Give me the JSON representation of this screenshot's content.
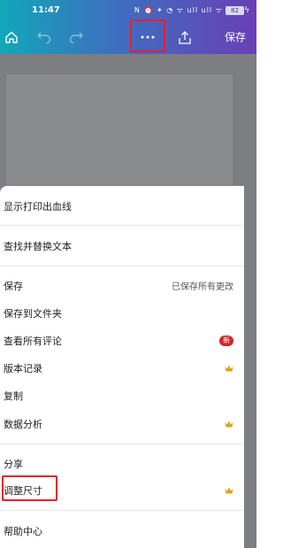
{
  "status_bar": {
    "time": "11:47",
    "icons_text": "N ⏰ ✦ ◔ ᯤ ull ull ᯤ",
    "battery": "82",
    "bolt": "ϟ"
  },
  "toolbar": {
    "save_label": "保存",
    "icons": [
      "home-icon",
      "undo-icon",
      "redo-icon",
      "more-icon",
      "share-upload-icon"
    ]
  },
  "menu": {
    "print_bleed": "显示打印出血线",
    "find_replace": "查找并替换文本",
    "save": "保存",
    "save_status": "已保存所有更改",
    "save_to_folder": "保存到文件夹",
    "view_comments": "查看所有评论",
    "new_badge": "新",
    "version_history": "版本记录",
    "copy": "复制",
    "data_analysis": "数据分析",
    "share": "分享",
    "resize": "调整尺寸",
    "help_center": "帮助中心"
  },
  "colors": {
    "accent_red": "#e8202a",
    "crown_gold": "#e0a21a",
    "badge_red": "#d4232e"
  }
}
